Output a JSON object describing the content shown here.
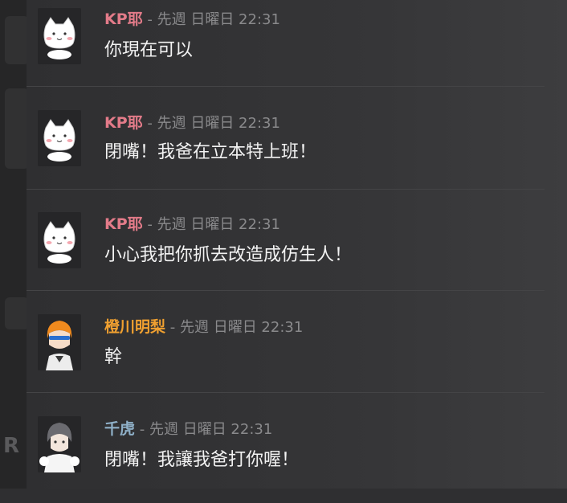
{
  "colors": {
    "author_pink": "#e37b89",
    "author_orange": "#f0a030",
    "author_blue": "#8fb0c8",
    "timestamp": "#8a8a8c",
    "message_text": "#f2f2f2",
    "background": "#2f2f31"
  },
  "messages": [
    {
      "author": "KP耶",
      "sep": " - ",
      "timestamp": "先週 日曜日 22:31",
      "text": "你現在可以",
      "avatar_icon": "cat-avatar"
    },
    {
      "author": "KP耶",
      "sep": " - ",
      "timestamp": "先週 日曜日 22:31",
      "text": "閉嘴！我爸在立本特上班！",
      "avatar_icon": "cat-avatar"
    },
    {
      "author": "KP耶",
      "sep": " - ",
      "timestamp": "先週 日曜日 22:31",
      "text": "小心我把你抓去改造成仿生人！",
      "avatar_icon": "cat-avatar"
    },
    {
      "author": "橙川明梨",
      "sep": " - ",
      "timestamp": "先週 日曜日 22:31",
      "text": "幹",
      "avatar_icon": "orange-hair-avatar"
    },
    {
      "author": "千虎",
      "sep": " - ",
      "timestamp": "先週 日曜日 22:31",
      "text": "閉嘴！我讓我爸打你喔！",
      "avatar_icon": "gray-hair-avatar"
    }
  ]
}
